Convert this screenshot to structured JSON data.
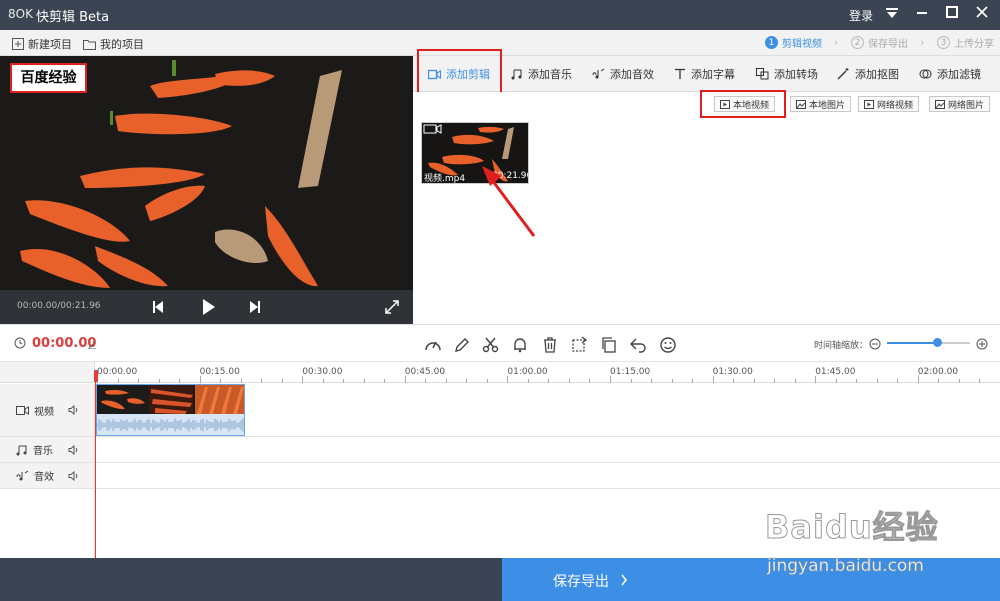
{
  "titlebar": {
    "logo": "8OK",
    "app_name": "快剪辑 Beta",
    "login": "登录",
    "dropdown_icon": "triangle-down-icon",
    "min_icon": "minimize-icon",
    "max_icon": "maximize-icon",
    "close_icon": "close-icon"
  },
  "menubar": {
    "new_project": "新建项目",
    "my_projects": "我的项目",
    "steps": [
      {
        "num": "1",
        "label": "剪辑视频"
      },
      {
        "num": "2",
        "label": "保存导出"
      },
      {
        "num": "3",
        "label": "上传分享"
      }
    ]
  },
  "preview": {
    "watermark": "百度经验",
    "time": "00:00.00/00:21.96"
  },
  "tabs": [
    {
      "label": "添加剪辑"
    },
    {
      "label": "添加音乐"
    },
    {
      "label": "添加音效"
    },
    {
      "label": "添加字幕"
    },
    {
      "label": "添加转场"
    },
    {
      "label": "添加抠图"
    },
    {
      "label": "添加滤镜"
    }
  ],
  "source_buttons": [
    "本地视频",
    "本地图片",
    "网络视频",
    "网络图片"
  ],
  "asset": {
    "name": "视频.mp4",
    "duration": "00:21.96"
  },
  "timeline": {
    "current_time": "00:00.00",
    "zoom_label": "时间轴缩放：",
    "zoom_level": 0.6,
    "ruler": [
      "00:00.00",
      "00:15.00",
      "00:30.00",
      "00:45.00",
      "01:00.00",
      "01:15.00",
      "01:30.00",
      "01:45.00",
      "02:00.00"
    ],
    "tracks": [
      {
        "label": "视频"
      },
      {
        "label": "音乐"
      },
      {
        "label": "音效"
      }
    ]
  },
  "footer": {
    "save_label": "保存导出"
  },
  "branding": {
    "baidu_text": "Baidu经验",
    "baidu_url": "jingyan.baidu.com"
  }
}
